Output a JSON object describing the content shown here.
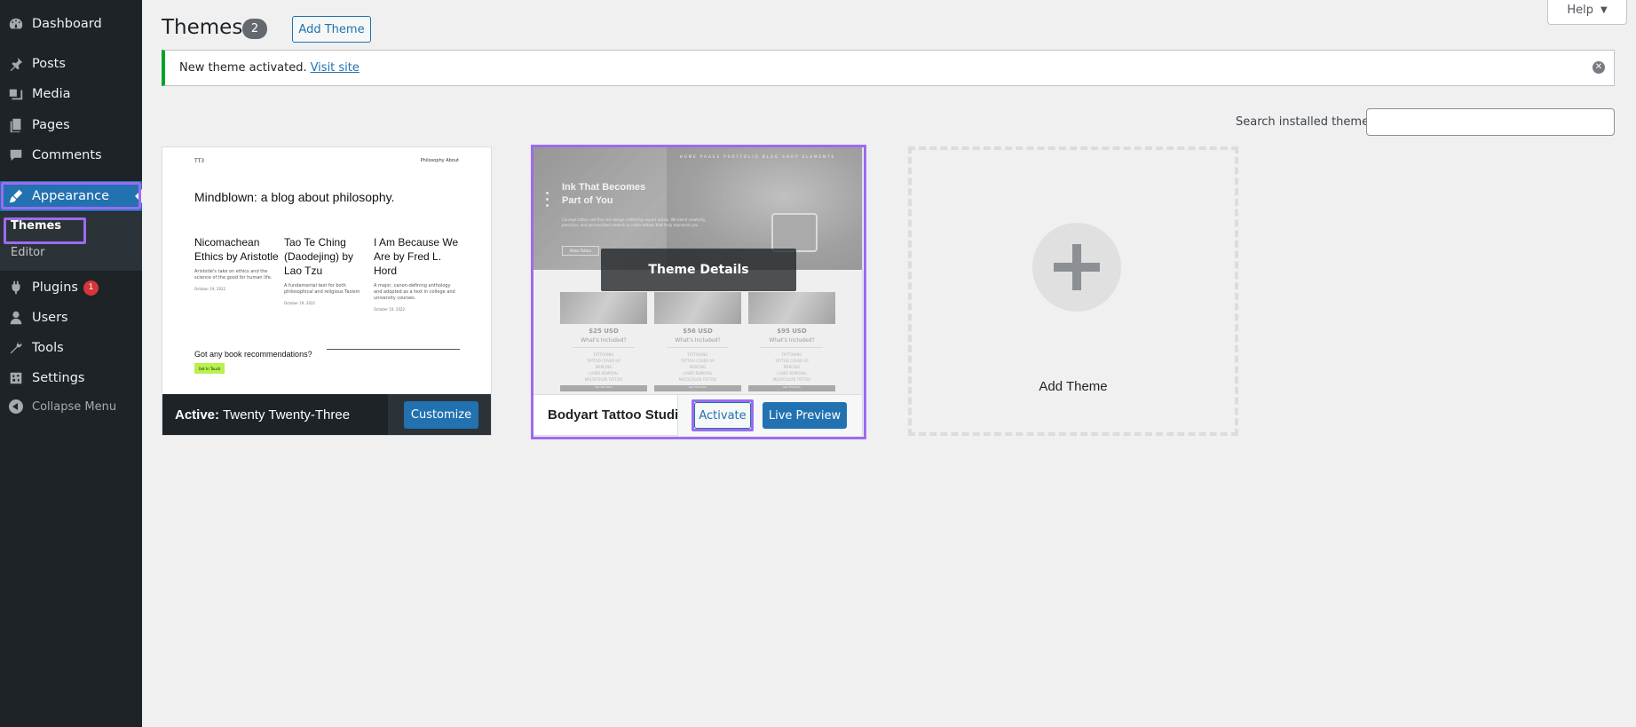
{
  "sidebar": {
    "items": [
      {
        "label": "Dashboard",
        "icon": "dashboard-icon"
      },
      {
        "label": "Posts",
        "icon": "pin-icon"
      },
      {
        "label": "Media",
        "icon": "media-icon"
      },
      {
        "label": "Pages",
        "icon": "pages-icon"
      },
      {
        "label": "Comments",
        "icon": "comments-icon"
      },
      {
        "label": "Appearance",
        "icon": "brush-icon"
      },
      {
        "label": "Plugins",
        "icon": "plugin-icon",
        "badge": "1"
      },
      {
        "label": "Users",
        "icon": "users-icon"
      },
      {
        "label": "Tools",
        "icon": "wrench-icon"
      },
      {
        "label": "Settings",
        "icon": "settings-icon"
      },
      {
        "label": "Collapse Menu",
        "icon": "collapse-icon"
      }
    ],
    "submenu": {
      "themes": "Themes",
      "editor": "Editor"
    }
  },
  "header": {
    "title": "Themes",
    "count": "2",
    "add_theme": "Add Theme",
    "help": "Help"
  },
  "notice": {
    "text": "New theme activated.",
    "link": "Visit site"
  },
  "search": {
    "label": "Search installed themes",
    "value": ""
  },
  "themes": {
    "active": {
      "prefix": "Active:",
      "name": "Twenty Twenty-Three",
      "customize": "Customize",
      "preview": {
        "site": "TT3",
        "nav": "Philosophy   About",
        "headline": "Mindblown: a blog about philosophy.",
        "posts": [
          {
            "title": "Nicomachean Ethics by Aristotle",
            "excerpt": "Aristotle's take on ethics and the science of the good for human life.",
            "date": "October 19, 2022"
          },
          {
            "title": "Tao Te Ching (Daodejing) by Lao Tzu",
            "excerpt": "A fundamental text for both philosophical and religious Taoism",
            "date": "October 19, 2022"
          },
          {
            "title": "I Am Because We Are by Fred L. Hord",
            "excerpt": "A major, canon-defining anthology and adopted as a text in college and university courses.",
            "date": "October 19, 2022"
          }
        ],
        "question": "Got any book recommendations?",
        "cta": "Get In Touch"
      }
    },
    "bodyart": {
      "name": "Bodyart Tattoo Studio",
      "details": "Theme Details",
      "activate": "Activate",
      "live_preview": "Live Preview",
      "preview": {
        "title_line1": "Ink That Becomes",
        "title_line2": "Part of You",
        "text": "Concept tattoo and fine line design crafted by expert artists. We blend creativity, precision, and personalized artwork to make tattoos that truly represent you.",
        "nav": "HOME  PAGES  PORTFOLIO  BLOG  SHOP  ELEMENTS",
        "button": "Make Tattoo",
        "prices": [
          {
            "amount": "$25 USD",
            "included": "What's Included?",
            "list": "TATTOOING\nTATTOO COVER UP\nPIERCING\nLASER REMOVAL\nMULTICOLOR TATTOO",
            "btn": "Get This Plan"
          },
          {
            "amount": "$56 USD",
            "included": "What's Included?",
            "list": "TATTOOING\nTATTOO COVER UP\nPIERCING\nLASER REMOVAL\nMULTICOLOR TATTOO",
            "btn": "Get This Plan"
          },
          {
            "amount": "$95 USD",
            "included": "What's Included?",
            "list": "TATTOOING\nTATTOO COVER UP\nPIERCING\nLASER REMOVAL\nMULTICOLOR TATTOO",
            "btn": "Get This Plan"
          }
        ]
      }
    },
    "add_new": "Add Theme"
  },
  "colors": {
    "sidebar_bg": "#1d2327",
    "accent": "#2271b1",
    "highlight_outline": "#9b6cf0",
    "notice_success": "#00a32a",
    "badge": "#d63638"
  }
}
